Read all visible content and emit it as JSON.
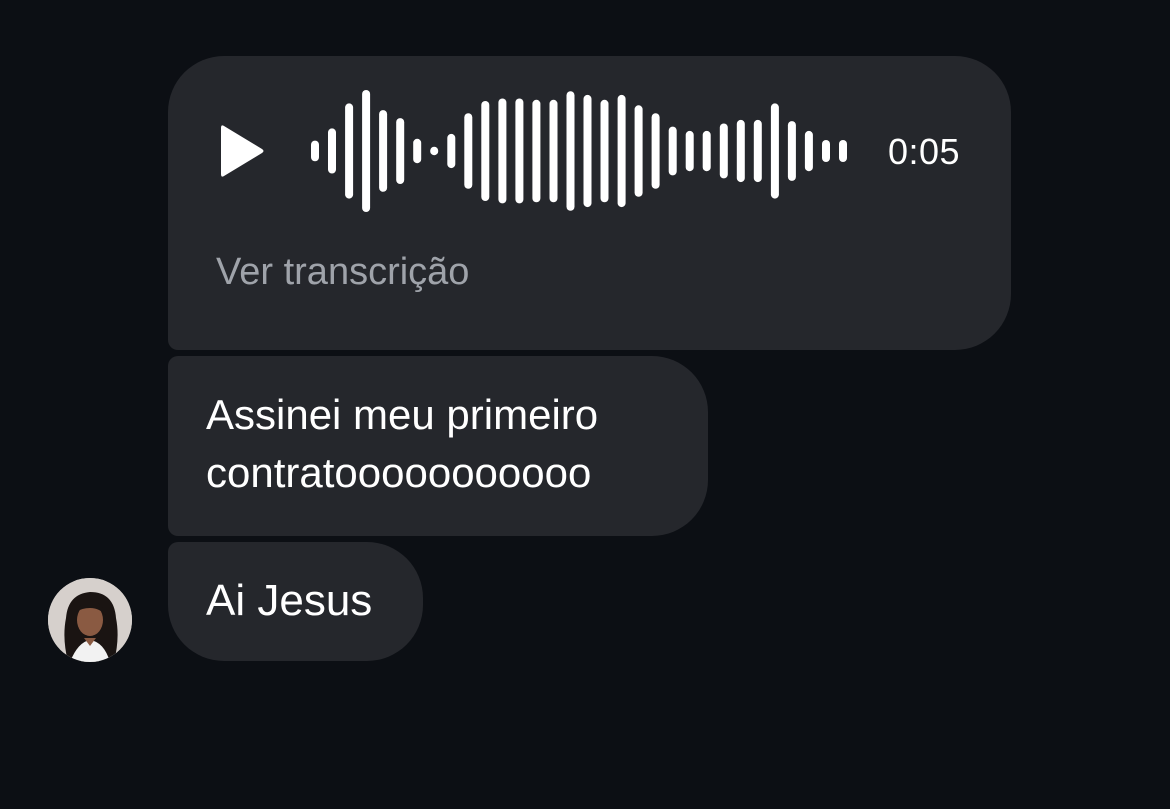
{
  "voice_message": {
    "duration": "0:05",
    "transcript_link": "Ver transcrição",
    "waveform_levels": [
      0.17,
      0.37,
      0.78,
      1.0,
      0.67,
      0.54,
      0.2,
      0.07,
      0.28,
      0.62,
      0.82,
      0.86,
      0.86,
      0.84,
      0.84,
      0.98,
      0.92,
      0.84,
      0.92,
      0.75,
      0.62,
      0.4,
      0.33,
      0.33,
      0.45,
      0.51,
      0.51,
      0.78,
      0.49,
      0.33,
      0.18,
      0.18
    ]
  },
  "messages": [
    {
      "text": "Assinei meu primeiro contratooooooooooo"
    },
    {
      "text": "Ai Jesus"
    }
  ],
  "colors": {
    "background": "#0c0f14",
    "bubble": "#25272c",
    "text": "#ffffff",
    "secondary_text": "#9fa3aa"
  },
  "icons": {
    "play": "play-icon",
    "avatar": "profile-photo"
  }
}
